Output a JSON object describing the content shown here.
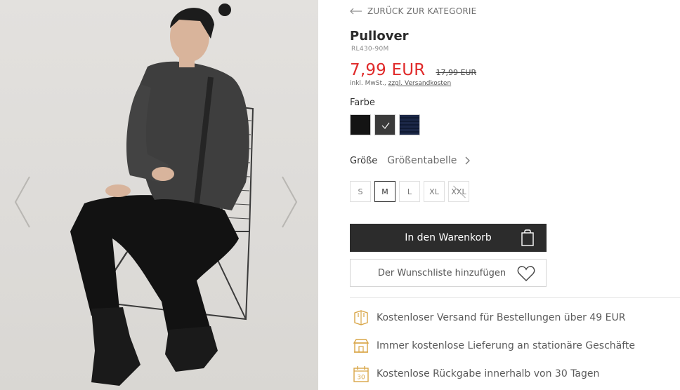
{
  "nav": {
    "back_label": "ZURÜCK ZUR KATEGORIE",
    "back_icon": "arrow-left-icon"
  },
  "product": {
    "title": "Pullover",
    "sku": "RL430-90M",
    "price_current": "7,99 EUR",
    "price_old": "17,99 EUR",
    "tax_prefix": "inkl. MwSt.,",
    "tax_link": "zzgl. Versandkosten"
  },
  "colors": {
    "label": "Farbe",
    "options": [
      {
        "name": "black",
        "hex": "#141414",
        "selected": false
      },
      {
        "name": "dark-grey",
        "hex": "#3a3a3a",
        "selected": true
      },
      {
        "name": "navy",
        "hex": "#1b2747",
        "selected": false
      }
    ]
  },
  "sizes": {
    "label": "Größe",
    "table_label": "Größentabelle",
    "options": [
      {
        "label": "S",
        "selected": false,
        "available": true
      },
      {
        "label": "M",
        "selected": true,
        "available": true
      },
      {
        "label": "L",
        "selected": false,
        "available": true
      },
      {
        "label": "XL",
        "selected": false,
        "available": true
      },
      {
        "label": "XXL",
        "selected": false,
        "available": false
      }
    ]
  },
  "actions": {
    "cart_label": "In den Warenkorb",
    "wishlist_label": "Der Wunschliste hinzufügen"
  },
  "perks": [
    {
      "icon": "free-shipping-box-icon",
      "text": "Kostenloser Versand für Bestellungen über 49 EUR"
    },
    {
      "icon": "store-icon",
      "text": "Immer kostenlose Lieferung an stationäre Geschäfte"
    },
    {
      "icon": "calendar-30-icon",
      "text": "Kostenlose Rückgabe innerhalb von 30 Tagen",
      "badge": "30"
    }
  ],
  "theme": {
    "accent_red": "#e02a2a",
    "button_dark": "#2c2c2c",
    "perk_icon_gold": "#d9a648"
  }
}
